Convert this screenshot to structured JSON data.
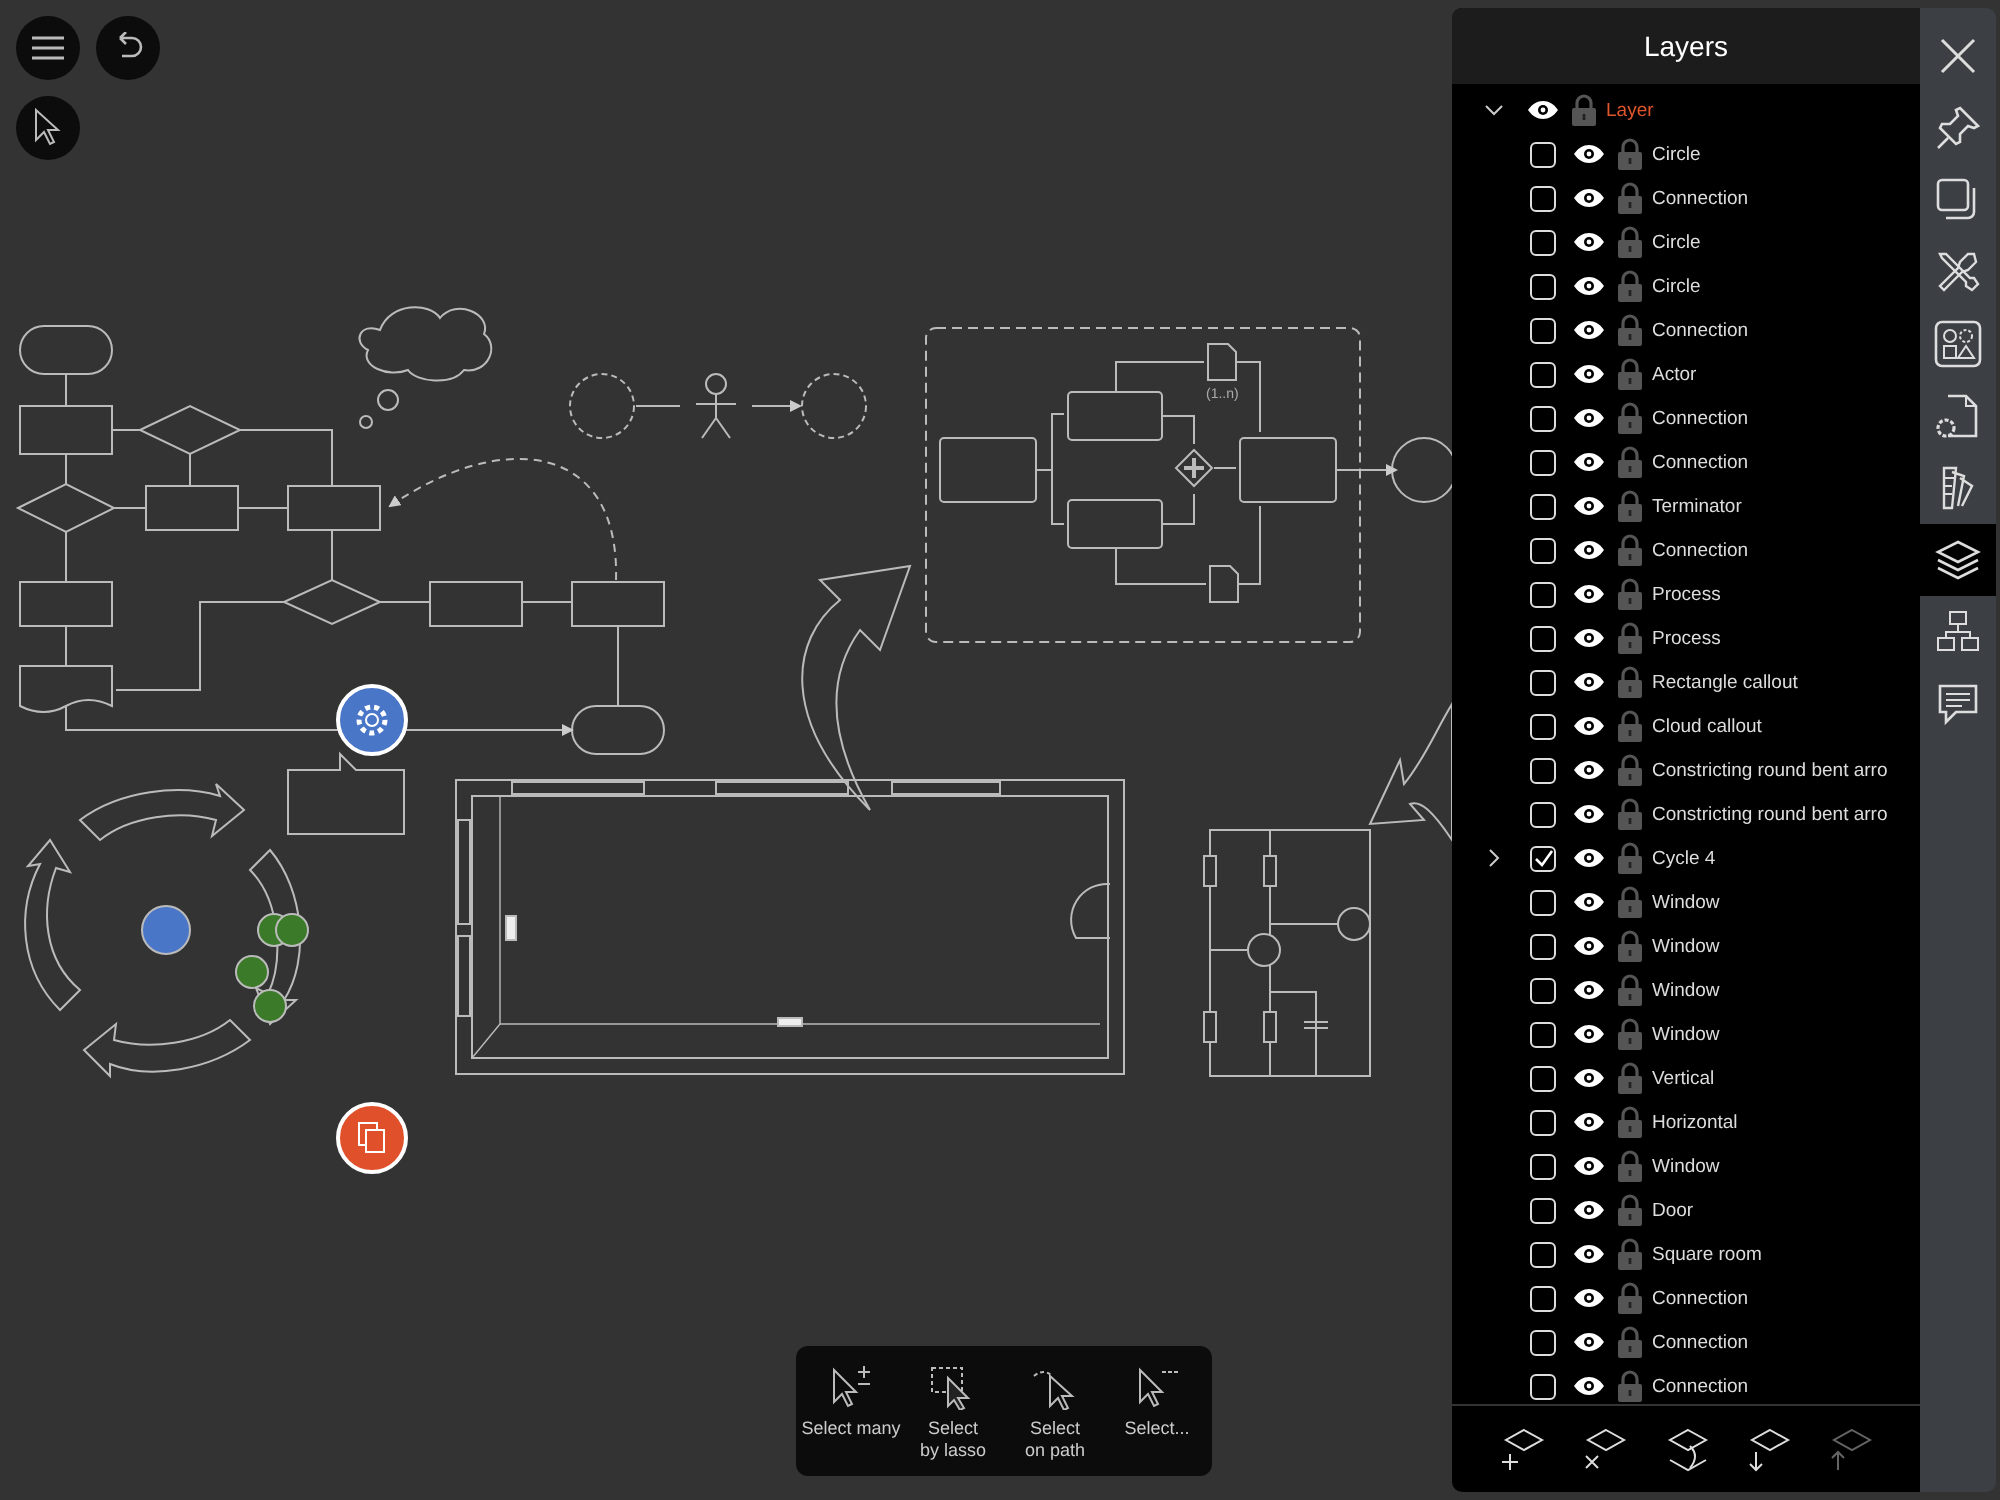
{
  "canvas": {
    "data_object_label": "(1..n)"
  },
  "select_toolbar": [
    {
      "kind": "many",
      "label": "Select many"
    },
    {
      "kind": "lasso",
      "label": "Select\nby lasso"
    },
    {
      "kind": "path",
      "label": "Select\non path"
    },
    {
      "kind": "more",
      "label": "Select..."
    }
  ],
  "layers_panel": {
    "title": "Layers",
    "layer": {
      "name": "Layer",
      "expanded": true,
      "children": [
        {
          "name": "Circle",
          "kind": "shape",
          "checked": false
        },
        {
          "name": "Connection",
          "kind": "shape",
          "checked": false
        },
        {
          "name": "Circle",
          "kind": "shape",
          "checked": false
        },
        {
          "name": "Circle",
          "kind": "shape",
          "checked": false
        },
        {
          "name": "Connection",
          "kind": "shape",
          "checked": false
        },
        {
          "name": "Actor",
          "kind": "shape",
          "checked": false
        },
        {
          "name": "Connection",
          "kind": "shape",
          "checked": false
        },
        {
          "name": "Connection",
          "kind": "shape",
          "checked": false
        },
        {
          "name": "Terminator",
          "kind": "shape",
          "checked": false
        },
        {
          "name": "Connection",
          "kind": "shape",
          "checked": false
        },
        {
          "name": "Process",
          "kind": "shape",
          "checked": false
        },
        {
          "name": "Process",
          "kind": "shape",
          "checked": false
        },
        {
          "name": "Rectangle callout",
          "kind": "shape",
          "checked": false
        },
        {
          "name": "Cloud callout",
          "kind": "shape",
          "checked": false
        },
        {
          "name": "Constricting round bent arro",
          "kind": "shape",
          "checked": false
        },
        {
          "name": "Constricting round bent arro",
          "kind": "shape",
          "checked": false
        },
        {
          "name": "Cycle 4",
          "kind": "group",
          "expanded": false,
          "checked": true
        },
        {
          "name": "Window",
          "kind": "shape",
          "checked": false
        },
        {
          "name": "Window",
          "kind": "shape",
          "checked": false
        },
        {
          "name": "Window",
          "kind": "shape",
          "checked": false
        },
        {
          "name": "Window",
          "kind": "shape",
          "checked": false
        },
        {
          "name": "Vertical",
          "kind": "shape",
          "checked": false
        },
        {
          "name": "Horizontal",
          "kind": "shape",
          "checked": false
        },
        {
          "name": "Window",
          "kind": "shape",
          "checked": false
        },
        {
          "name": "Door",
          "kind": "shape",
          "checked": false
        },
        {
          "name": "Square room",
          "kind": "shape",
          "checked": false
        },
        {
          "name": "Connection",
          "kind": "shape",
          "checked": false
        },
        {
          "name": "Connection",
          "kind": "shape",
          "checked": false
        },
        {
          "name": "Connection",
          "kind": "shape",
          "checked": false
        }
      ]
    },
    "actions": [
      {
        "kind": "add",
        "disabled": false
      },
      {
        "kind": "delete",
        "disabled": false
      },
      {
        "kind": "merge",
        "disabled": false
      },
      {
        "kind": "down",
        "disabled": false
      },
      {
        "kind": "up",
        "disabled": true
      }
    ]
  },
  "side_rail": [
    {
      "kind": "close",
      "selected": false
    },
    {
      "kind": "pin",
      "selected": false
    },
    {
      "kind": "duplicate",
      "selected": false
    },
    {
      "kind": "tools",
      "selected": false
    },
    {
      "kind": "shapes",
      "selected": false
    },
    {
      "kind": "document",
      "selected": false
    },
    {
      "kind": "swatches",
      "selected": false
    },
    {
      "kind": "layers",
      "selected": true
    },
    {
      "kind": "hierarchy",
      "selected": false
    },
    {
      "kind": "comment",
      "selected": false
    }
  ]
}
